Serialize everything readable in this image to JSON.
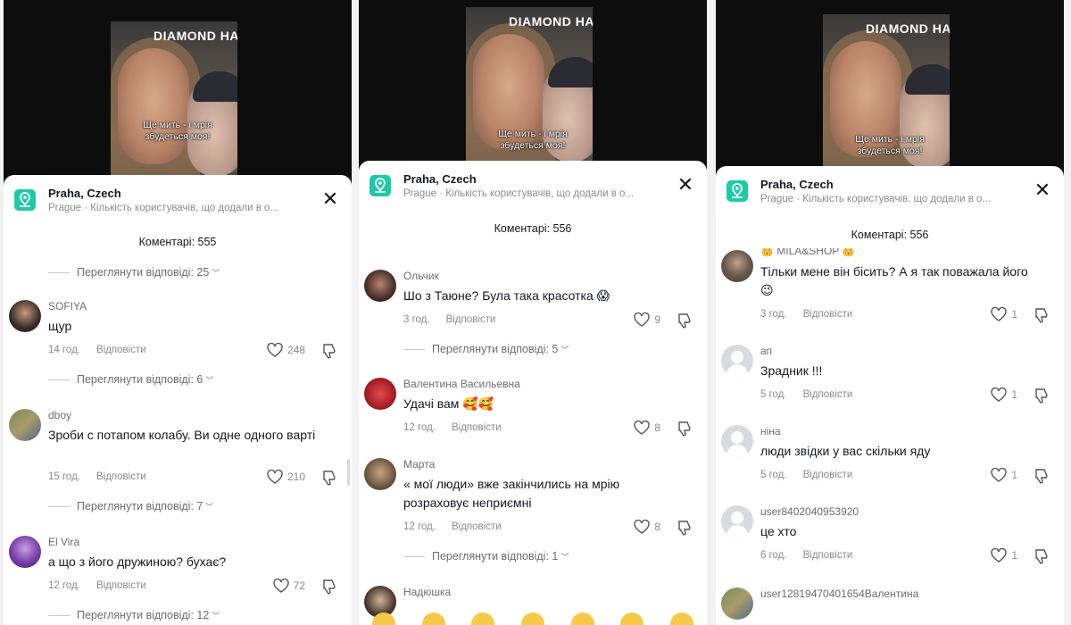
{
  "panels": [
    {
      "video": {
        "sign": "DIAMOND HA",
        "caption_line1": "Ще мить - і мрія",
        "caption_line2": "збудеться моя!"
      },
      "location": {
        "title": "Praha, Czech",
        "subtitle": "Prague · Кількість користувачів, що додали в о..."
      },
      "comment_count": "Коментарі: 555",
      "top_replies": "Переглянути відповіді: 25",
      "comments": [
        {
          "user": "SOFIYA",
          "text": "щур",
          "time": "14 год.",
          "reply": "Відповісти",
          "likes": "248",
          "replies": "Переглянути відповіді: 6"
        },
        {
          "user": "dboy",
          "text": "Зроби с потапом колабу. Ви одне одного варті",
          "time": "15 год.",
          "reply": "Відповісти",
          "likes": "210",
          "replies": "Переглянути відповіді: 7"
        },
        {
          "user": "El Vira",
          "text": "а що з його дружиною? бухає?",
          "time": "12 год.",
          "reply": "Відповісти",
          "likes": "72",
          "replies": "Переглянути відповіді: 12"
        }
      ]
    },
    {
      "video": {
        "sign": "DIAMOND HA",
        "caption_line1": "Ще мить - і мрія",
        "caption_line2": "збудеться моя!"
      },
      "location": {
        "title": "Praha, Czech",
        "subtitle": "Prague · Кількість користувачів, що додали в о..."
      },
      "comment_count": "Коментарі: 556",
      "comments": [
        {
          "user": "Ольчик",
          "text": "Шо з Таюне? Була така красотка 😱",
          "time": "3 год.",
          "reply": "Відповісти",
          "likes": "9",
          "replies": "Переглянути відповіді: 5"
        },
        {
          "user": "Валентина Васильевна",
          "text": "Удачі вам 🥰🥰",
          "time": "12 год.",
          "reply": "Відповісти",
          "likes": "8"
        },
        {
          "user": "Марта",
          "text": "« мої люди» вже закінчились на мрію розраховує неприємні",
          "time": "12 год.",
          "reply": "Відповісти",
          "likes": "8",
          "replies": "Переглянути відповіді: 1"
        },
        {
          "user": "Надюшка"
        }
      ]
    },
    {
      "video": {
        "sign": "DIAMOND HA",
        "caption_line1": "Ще мить - і мрія",
        "caption_line2": "збудеться моя!"
      },
      "location": {
        "title": "Praha, Czech",
        "subtitle": "Prague · Кількість користувачів, що додали в о..."
      },
      "comment_count": "Коментарі: 556",
      "comments": [
        {
          "user": "👑 MILA&SHOP 👑",
          "text": "Тільки мене він бісить? А я так поважала його 😉",
          "time": "3 год.",
          "reply": "Відповісти",
          "likes": "1"
        },
        {
          "user": "ап",
          "text": "Зрадник !!!",
          "time": "5 год.",
          "reply": "Відповісти",
          "likes": "1"
        },
        {
          "user": "ніна",
          "text": "люди звідки у вас скільки яду",
          "time": "5 год.",
          "reply": "Відповісти",
          "likes": "1"
        },
        {
          "user": "user8402040953920",
          "text": "це хто",
          "time": "6 год.",
          "reply": "Відповісти",
          "likes": "1"
        },
        {
          "user": "user12819470401654Валентина"
        }
      ]
    }
  ]
}
